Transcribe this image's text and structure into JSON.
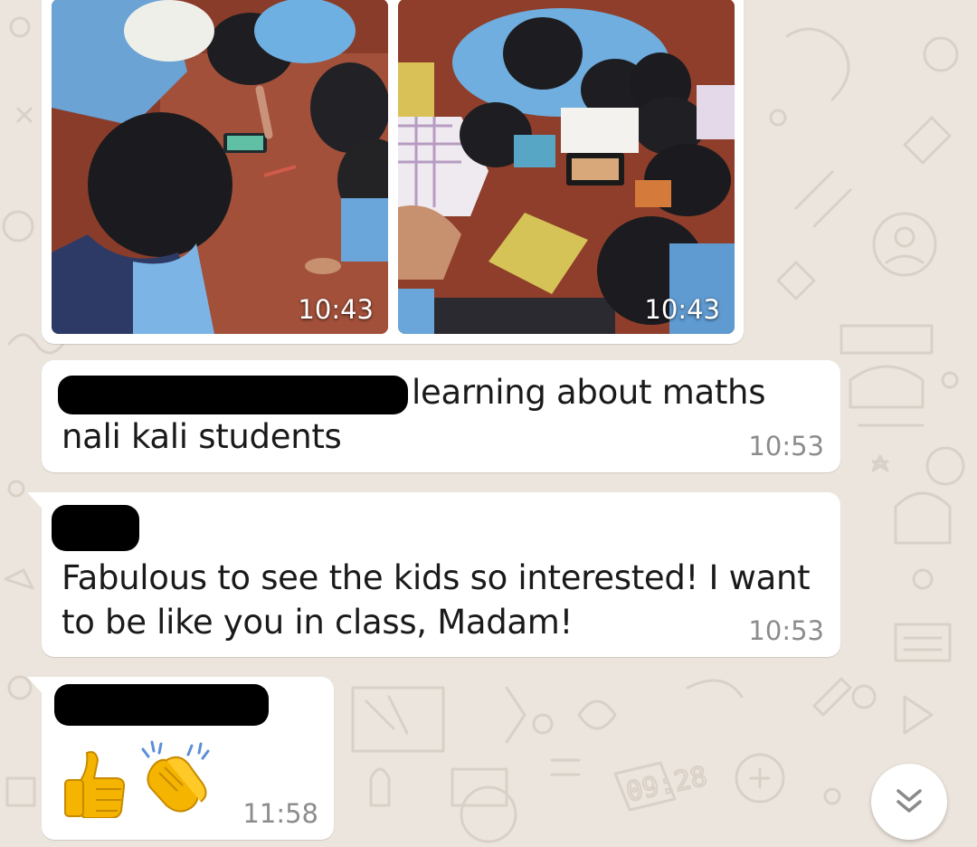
{
  "chat": {
    "messages": [
      {
        "type": "images",
        "images": [
          {
            "time": "10:43"
          },
          {
            "time": "10:43"
          }
        ]
      },
      {
        "type": "text",
        "text": "learning about  maths",
        "text_line2": "nali kali students",
        "time": "10:53"
      },
      {
        "type": "text",
        "text_line1": "Fabulous to see the kids so interested! I want",
        "text_line2": "to be like you in class, Madam!",
        "time": "10:53"
      },
      {
        "type": "emoji",
        "emojis": [
          "thumbs-up",
          "clapping-hands"
        ],
        "time": "11:58"
      }
    ]
  },
  "colors": {
    "wallpaper": "#ece5dd",
    "bubble": "#ffffff",
    "timestamp": "#8c8c8c",
    "redaction": "#000000"
  }
}
